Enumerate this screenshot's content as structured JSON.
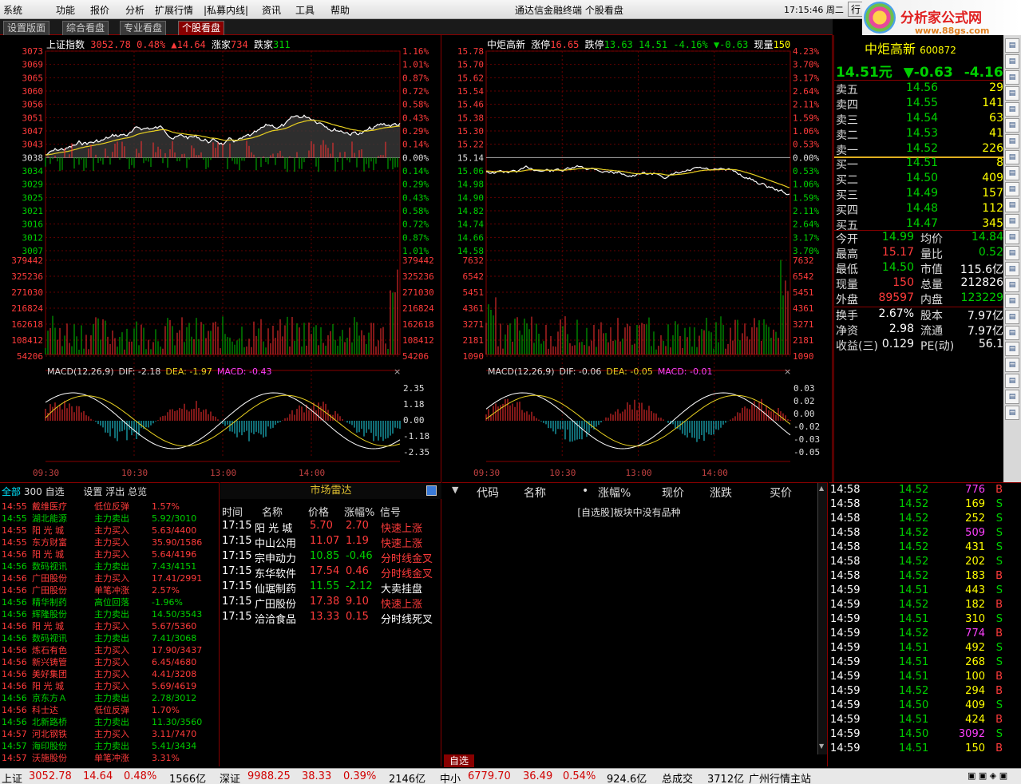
{
  "menu": [
    "系统",
    "功能",
    "报价",
    "分析",
    "扩展行情",
    "|私募内线|",
    "资讯",
    "工具",
    "帮助"
  ],
  "app_title": "通达信金融终端  个股看盘",
  "clock": "17:15:46 周二",
  "clock_btn": "行",
  "logo": {
    "name": "分析家公式网",
    "url": "www.88gs.com"
  },
  "tabs": [
    "设置版面",
    "综合看盘",
    "专业看盘",
    "个股看盘"
  ],
  "left_chart": {
    "header": {
      "name": "上证指数",
      "value": "3052.78",
      "pct": "0.48%",
      "chg": "▲14.64",
      "up_label": "涨家",
      "up": "734",
      "down_label": "跌家",
      "down": "311"
    },
    "price_ticks": [
      "3073",
      "3069",
      "3065",
      "3060",
      "3056",
      "3051",
      "3047",
      "3043",
      "3038",
      "3034",
      "3029",
      "3025",
      "3021",
      "3016",
      "3012",
      "3007"
    ],
    "pct_ticks": [
      "1.16%",
      "1.01%",
      "0.87%",
      "0.72%",
      "0.58%",
      "0.43%",
      "0.29%",
      "0.14%",
      "0.00%",
      "0.14%",
      "0.29%",
      "0.43%",
      "0.58%",
      "0.72%",
      "0.87%",
      "1.01%"
    ],
    "vol_ticks": [
      "379442",
      "325236",
      "271030",
      "216824",
      "162618",
      "108412",
      "54206"
    ],
    "macd_header": {
      "name": "MACD(12,26,9)",
      "dif": "DIF: -2.18",
      "dea": "DEA: -1.97",
      "macd": "MACD: -0.43"
    },
    "macd_ticks": [
      "2.35",
      "1.18",
      "0.00",
      "-1.18",
      "-2.35"
    ],
    "time_ticks": [
      "09:30",
      "10:30",
      "13:00",
      "14:00"
    ]
  },
  "right_chart": {
    "header": {
      "name": "中炬高新",
      "up_lim_label": "涨停",
      "up_lim": "16.65",
      "down_lim_label": "跌停",
      "down_lim": "13.63",
      "price": "14.51",
      "pct": "-4.16%",
      "chg": "▼-0.63",
      "vol_label": "现量",
      "vol": "150"
    },
    "price_ticks": [
      "15.78",
      "15.70",
      "15.62",
      "15.54",
      "15.46",
      "15.38",
      "15.30",
      "15.22",
      "15.14",
      "15.06",
      "14.98",
      "14.90",
      "14.82",
      "14.74",
      "14.66",
      "14.58"
    ],
    "pct_ticks": [
      "4.23%",
      "3.70%",
      "3.17%",
      "2.64%",
      "2.11%",
      "1.59%",
      "1.06%",
      "0.53%",
      "0.00%",
      "0.53%",
      "1.06%",
      "1.59%",
      "2.11%",
      "2.64%",
      "3.17%",
      "3.70%"
    ],
    "vol_ticks": [
      "7632",
      "6542",
      "5451",
      "4361",
      "3271",
      "2181",
      "1090"
    ],
    "macd_header": {
      "name": "MACD(12,26,9)",
      "dif": "DIF: -0.06",
      "dea": "DEA: -0.05",
      "macd": "MACD: -0.01"
    },
    "macd_ticks": [
      "0.03",
      "0.02",
      "0.00",
      "-0.02",
      "-0.03",
      "-0.05"
    ],
    "time_ticks": [
      "09:30",
      "10:30",
      "13:00",
      "14:00"
    ]
  },
  "quote": {
    "title": "中炬高新",
    "code": "600872",
    "price": "14.51元",
    "chg": "▼-0.63",
    "pct": "-4.16%",
    "asks": [
      [
        "卖五",
        "14.56",
        "29"
      ],
      [
        "卖四",
        "14.55",
        "141"
      ],
      [
        "卖三",
        "14.54",
        "63"
      ],
      [
        "卖二",
        "14.53",
        "41"
      ],
      [
        "卖一",
        "14.52",
        "226"
      ]
    ],
    "bids": [
      [
        "买一",
        "14.51",
        "8"
      ],
      [
        "买二",
        "14.50",
        "409"
      ],
      [
        "买三",
        "14.49",
        "157"
      ],
      [
        "买四",
        "14.48",
        "112"
      ],
      [
        "买五",
        "14.47",
        "345"
      ]
    ],
    "stats": [
      [
        "今开",
        "14.99",
        "均价",
        "14.84"
      ],
      [
        "最高",
        "15.17",
        "量比",
        "0.52"
      ],
      [
        "最低",
        "14.50",
        "市值",
        "115.6亿"
      ],
      [
        "现量",
        "150",
        "总量",
        "212826"
      ],
      [
        "外盘",
        "89597",
        "内盘",
        "123229"
      ]
    ],
    "stats2": [
      [
        "换手",
        "2.67%",
        "股本",
        "7.97亿"
      ],
      [
        "净资",
        "2.98",
        "流通",
        "7.97亿"
      ],
      [
        "收益(三)",
        "0.129",
        "PE(动)",
        "56.1"
      ]
    ]
  },
  "radar_tabs": [
    "全部",
    "300",
    "自选",
    "设置",
    "浮出",
    "总览"
  ],
  "radar_list": [
    [
      "14:55",
      "戴维医疗",
      "低位反弹",
      "1.57%"
    ],
    [
      "14:55",
      "湖北能源",
      "主力卖出",
      "5.92/3010"
    ],
    [
      "14:55",
      "阳 光 城",
      "主力买入",
      "5.63/4400"
    ],
    [
      "14:55",
      "东方财富",
      "主力买入",
      "35.90/1586"
    ],
    [
      "14:56",
      "阳 光 城",
      "主力买入",
      "5.64/4196"
    ],
    [
      "14:56",
      "数码视讯",
      "主力卖出",
      "7.43/4151"
    ],
    [
      "14:56",
      "广田股份",
      "主力买入",
      "17.41/2991"
    ],
    [
      "14:56",
      "广田股份",
      "单笔冲涨",
      "2.57%"
    ],
    [
      "14:56",
      "精华制药",
      "高位回落",
      "-1.96%"
    ],
    [
      "14:56",
      "辉隆股份",
      "主力卖出",
      "14.50/3543"
    ],
    [
      "14:56",
      "阳 光 城",
      "主力买入",
      "5.67/5360"
    ],
    [
      "14:56",
      "数码视讯",
      "主力卖出",
      "7.41/3068"
    ],
    [
      "14:56",
      "炼石有色",
      "主力买入",
      "17.90/3437"
    ],
    [
      "14:56",
      "新兴铸管",
      "主力买入",
      "6.45/4680"
    ],
    [
      "14:56",
      "美好集团",
      "主力买入",
      "4.41/3208"
    ],
    [
      "14:56",
      "阳 光 城",
      "主力买入",
      "5.69/4619"
    ],
    [
      "14:56",
      "京东方Ａ",
      "主力卖出",
      "2.78/3012"
    ],
    [
      "14:56",
      "科士达",
      "低位反弹",
      "1.70%"
    ],
    [
      "14:56",
      "北新路桥",
      "主力卖出",
      "11.30/3560"
    ],
    [
      "14:57",
      "河北钢铁",
      "主力买入",
      "3.11/7470"
    ],
    [
      "14:57",
      "海印股份",
      "主力卖出",
      "5.41/3434"
    ],
    [
      "14:57",
      "沃施股份",
      "单笔冲涨",
      "3.31%"
    ]
  ],
  "market_radar": {
    "title": "市场雷达",
    "headers": [
      "时间",
      "名称",
      "价格",
      "涨幅%",
      "信号"
    ],
    "rows": [
      [
        "17:15",
        "阳 光 城",
        "5.70",
        "2.70",
        "快速上涨"
      ],
      [
        "17:15",
        "中山公用",
        "11.07",
        "1.19",
        "快速上涨"
      ],
      [
        "17:15",
        "宗申动力",
        "10.85",
        "-0.46",
        "分时线金叉"
      ],
      [
        "17:15",
        "东华软件",
        "17.54",
        "0.46",
        "分时线金叉"
      ],
      [
        "17:15",
        "仙琚制药",
        "11.55",
        "-2.12",
        "大卖挂盘"
      ],
      [
        "17:15",
        "广田股份",
        "17.38",
        "9.10",
        "快速上涨"
      ],
      [
        "17:15",
        "洽洽食品",
        "13.33",
        "0.15",
        "分时线死叉"
      ]
    ]
  },
  "watchlist": {
    "headers": [
      "代码",
      "名称",
      "•",
      "涨幅%",
      "现价",
      "涨跌",
      "买价"
    ],
    "empty_msg": "[自选股]板块中没有品种",
    "tab": "自选"
  },
  "ticks": [
    [
      "14:58",
      "14.52",
      "776",
      "B"
    ],
    [
      "14:58",
      "14.52",
      "169",
      "S"
    ],
    [
      "14:58",
      "14.52",
      "252",
      "S"
    ],
    [
      "14:58",
      "14.52",
      "509",
      "S"
    ],
    [
      "14:58",
      "14.52",
      "431",
      "S"
    ],
    [
      "14:58",
      "14.52",
      "202",
      "S"
    ],
    [
      "14:58",
      "14.52",
      "183",
      "B"
    ],
    [
      "14:59",
      "14.51",
      "443",
      "S"
    ],
    [
      "14:59",
      "14.52",
      "182",
      "B"
    ],
    [
      "14:59",
      "14.51",
      "310",
      "S"
    ],
    [
      "14:59",
      "14.52",
      "774",
      "B"
    ],
    [
      "14:59",
      "14.51",
      "492",
      "S"
    ],
    [
      "14:59",
      "14.51",
      "268",
      "S"
    ],
    [
      "14:59",
      "14.51",
      "100",
      "B"
    ],
    [
      "14:59",
      "14.52",
      "294",
      "B"
    ],
    [
      "14:59",
      "14.50",
      "409",
      "S"
    ],
    [
      "14:59",
      "14.51",
      "424",
      "B"
    ],
    [
      "14:59",
      "14.50",
      "3092",
      "S"
    ],
    [
      "14:59",
      "14.51",
      "150",
      "B"
    ]
  ],
  "status": {
    "sh_label": "上证",
    "sh_val": "3052.78",
    "sh_chg": "14.64",
    "sh_pct": "0.48%",
    "sh_amt": "1566亿",
    "sz_label": "深证",
    "sz_val": "9988.25",
    "sz_chg": "38.33",
    "sz_pct": "0.39%",
    "sz_amt": "2146亿",
    "zx_label": "中小",
    "zx_val": "6779.70",
    "zx_chg": "36.49",
    "zx_pct": "0.54%",
    "zx_amt": "924.6亿",
    "total_label": "总成交",
    "total_amt": "3712亿",
    "server": "广州行情主站"
  }
}
